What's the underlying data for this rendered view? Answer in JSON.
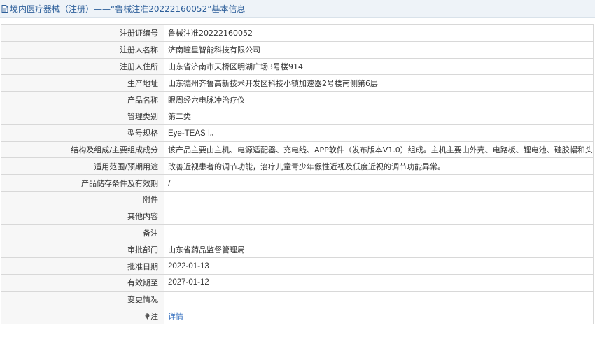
{
  "header": {
    "title": "境内医疗器械（注册）——“鲁械注准20222160052”基本信息"
  },
  "rows": [
    {
      "label": "注册证编号",
      "value": "鲁械注准20222160052"
    },
    {
      "label": "注册人名称",
      "value": "济南瞳星智能科技有限公司"
    },
    {
      "label": "注册人住所",
      "value": "山东省济南市天桥区明湖广场3号楼914"
    },
    {
      "label": "生产地址",
      "value": "山东德州齐鲁高新技术开发区科技小镇加速器2号楼南侧第6层"
    },
    {
      "label": "产品名称",
      "value": "眼周经穴电脉冲治疗仪"
    },
    {
      "label": "管理类别",
      "value": "第二类"
    },
    {
      "label": "型号规格",
      "value": "Eye-TEAS I。"
    },
    {
      "label": "结构及组成/主要组成成分",
      "value": "该产品主要由主机、电源适配器、充电线、APP软件（发布版本V1.0）组成。主机主要由外壳、电路板、锂电池、硅胶帽和头带组成。"
    },
    {
      "label": "适用范围/预期用途",
      "value": "改善近视患者的调节功能，治疗儿童青少年假性近视及低度近视的调节功能异常。"
    },
    {
      "label": "产品储存条件及有效期",
      "value": "/"
    },
    {
      "label": "附件",
      "value": ""
    },
    {
      "label": "其他内容",
      "value": ""
    },
    {
      "label": "备注",
      "value": ""
    },
    {
      "label": "审批部门",
      "value": "山东省药品监督管理局"
    },
    {
      "label": "批准日期",
      "value": "2022-01-13"
    },
    {
      "label": "有效期至",
      "value": "2027-01-12"
    },
    {
      "label": "变更情况",
      "value": ""
    },
    {
      "label": "注",
      "value": "详情"
    }
  ],
  "colors": {
    "header_bg": "#eef3f8",
    "header_text": "#2d5f9a",
    "label_bg": "#f7f7f7",
    "border": "#d8d8d8",
    "link": "#3b74c1"
  },
  "icons": [
    "document-icon",
    "pin-icon"
  ]
}
